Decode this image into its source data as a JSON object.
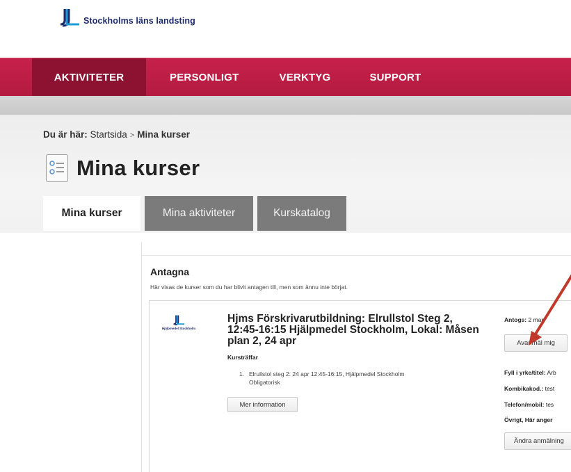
{
  "brand": {
    "name": "Stockholms läns landsting",
    "color": "#1d2a6b"
  },
  "topnav": {
    "items": [
      {
        "label": "AKTIVITETER"
      },
      {
        "label": "PERSONLIGT"
      },
      {
        "label": "VERKTYG"
      },
      {
        "label": "SUPPORT"
      }
    ],
    "accent": "#c6214a",
    "active_bg": "#8d1231"
  },
  "breadcrumb": {
    "prefix": "Du är här:",
    "home": "Startsida",
    "separator": ">",
    "current": "Mina kurser"
  },
  "page": {
    "title": "Mina kurser",
    "icon": "list-icon"
  },
  "tabs": [
    {
      "label": "Mina kurser"
    },
    {
      "label": "Mina aktiviteter"
    },
    {
      "label": "Kurskatalog"
    }
  ],
  "section": {
    "title": "Antagna",
    "description": "Här visas de kurser som du har blivit antagen till, men som ännu inte börjat."
  },
  "course": {
    "org_logo_text": "Hjälpmedel Stockholm",
    "title": "Hjms Förskrivarutbildning: Elrullstol Steg 2, 12:45-16:15 Hjälpmedel Stockholm, Lokal: Måsen plan 2, 24 apr",
    "subhead": "Kursträffar",
    "meetings": [
      {
        "number": "1.",
        "line1": "Elrullstol steg 2: 24 apr 12:45-16:15, Hjälpmedel Stockholm",
        "line2": "Obligatorisk"
      }
    ],
    "more_button": "Mer information",
    "antogs_label": "Antogs:",
    "antogs_value": "2 mar",
    "unregister_button": "Avanmäl mig",
    "fields": {
      "yrke_label": "Fyll i yrke/titel:",
      "yrke_value": "Arb",
      "kombi_label": "Kombikakod.:",
      "kombi_value": "test",
      "tel_label": "Telefon/mobil:",
      "tel_value": "tes",
      "ovrigt_label": "Övrigt, Här anger",
      "ovrigt_value": ""
    },
    "change_button": "Ändra anmälning"
  },
  "annotation": {
    "arrow_color": "#c0392b"
  }
}
